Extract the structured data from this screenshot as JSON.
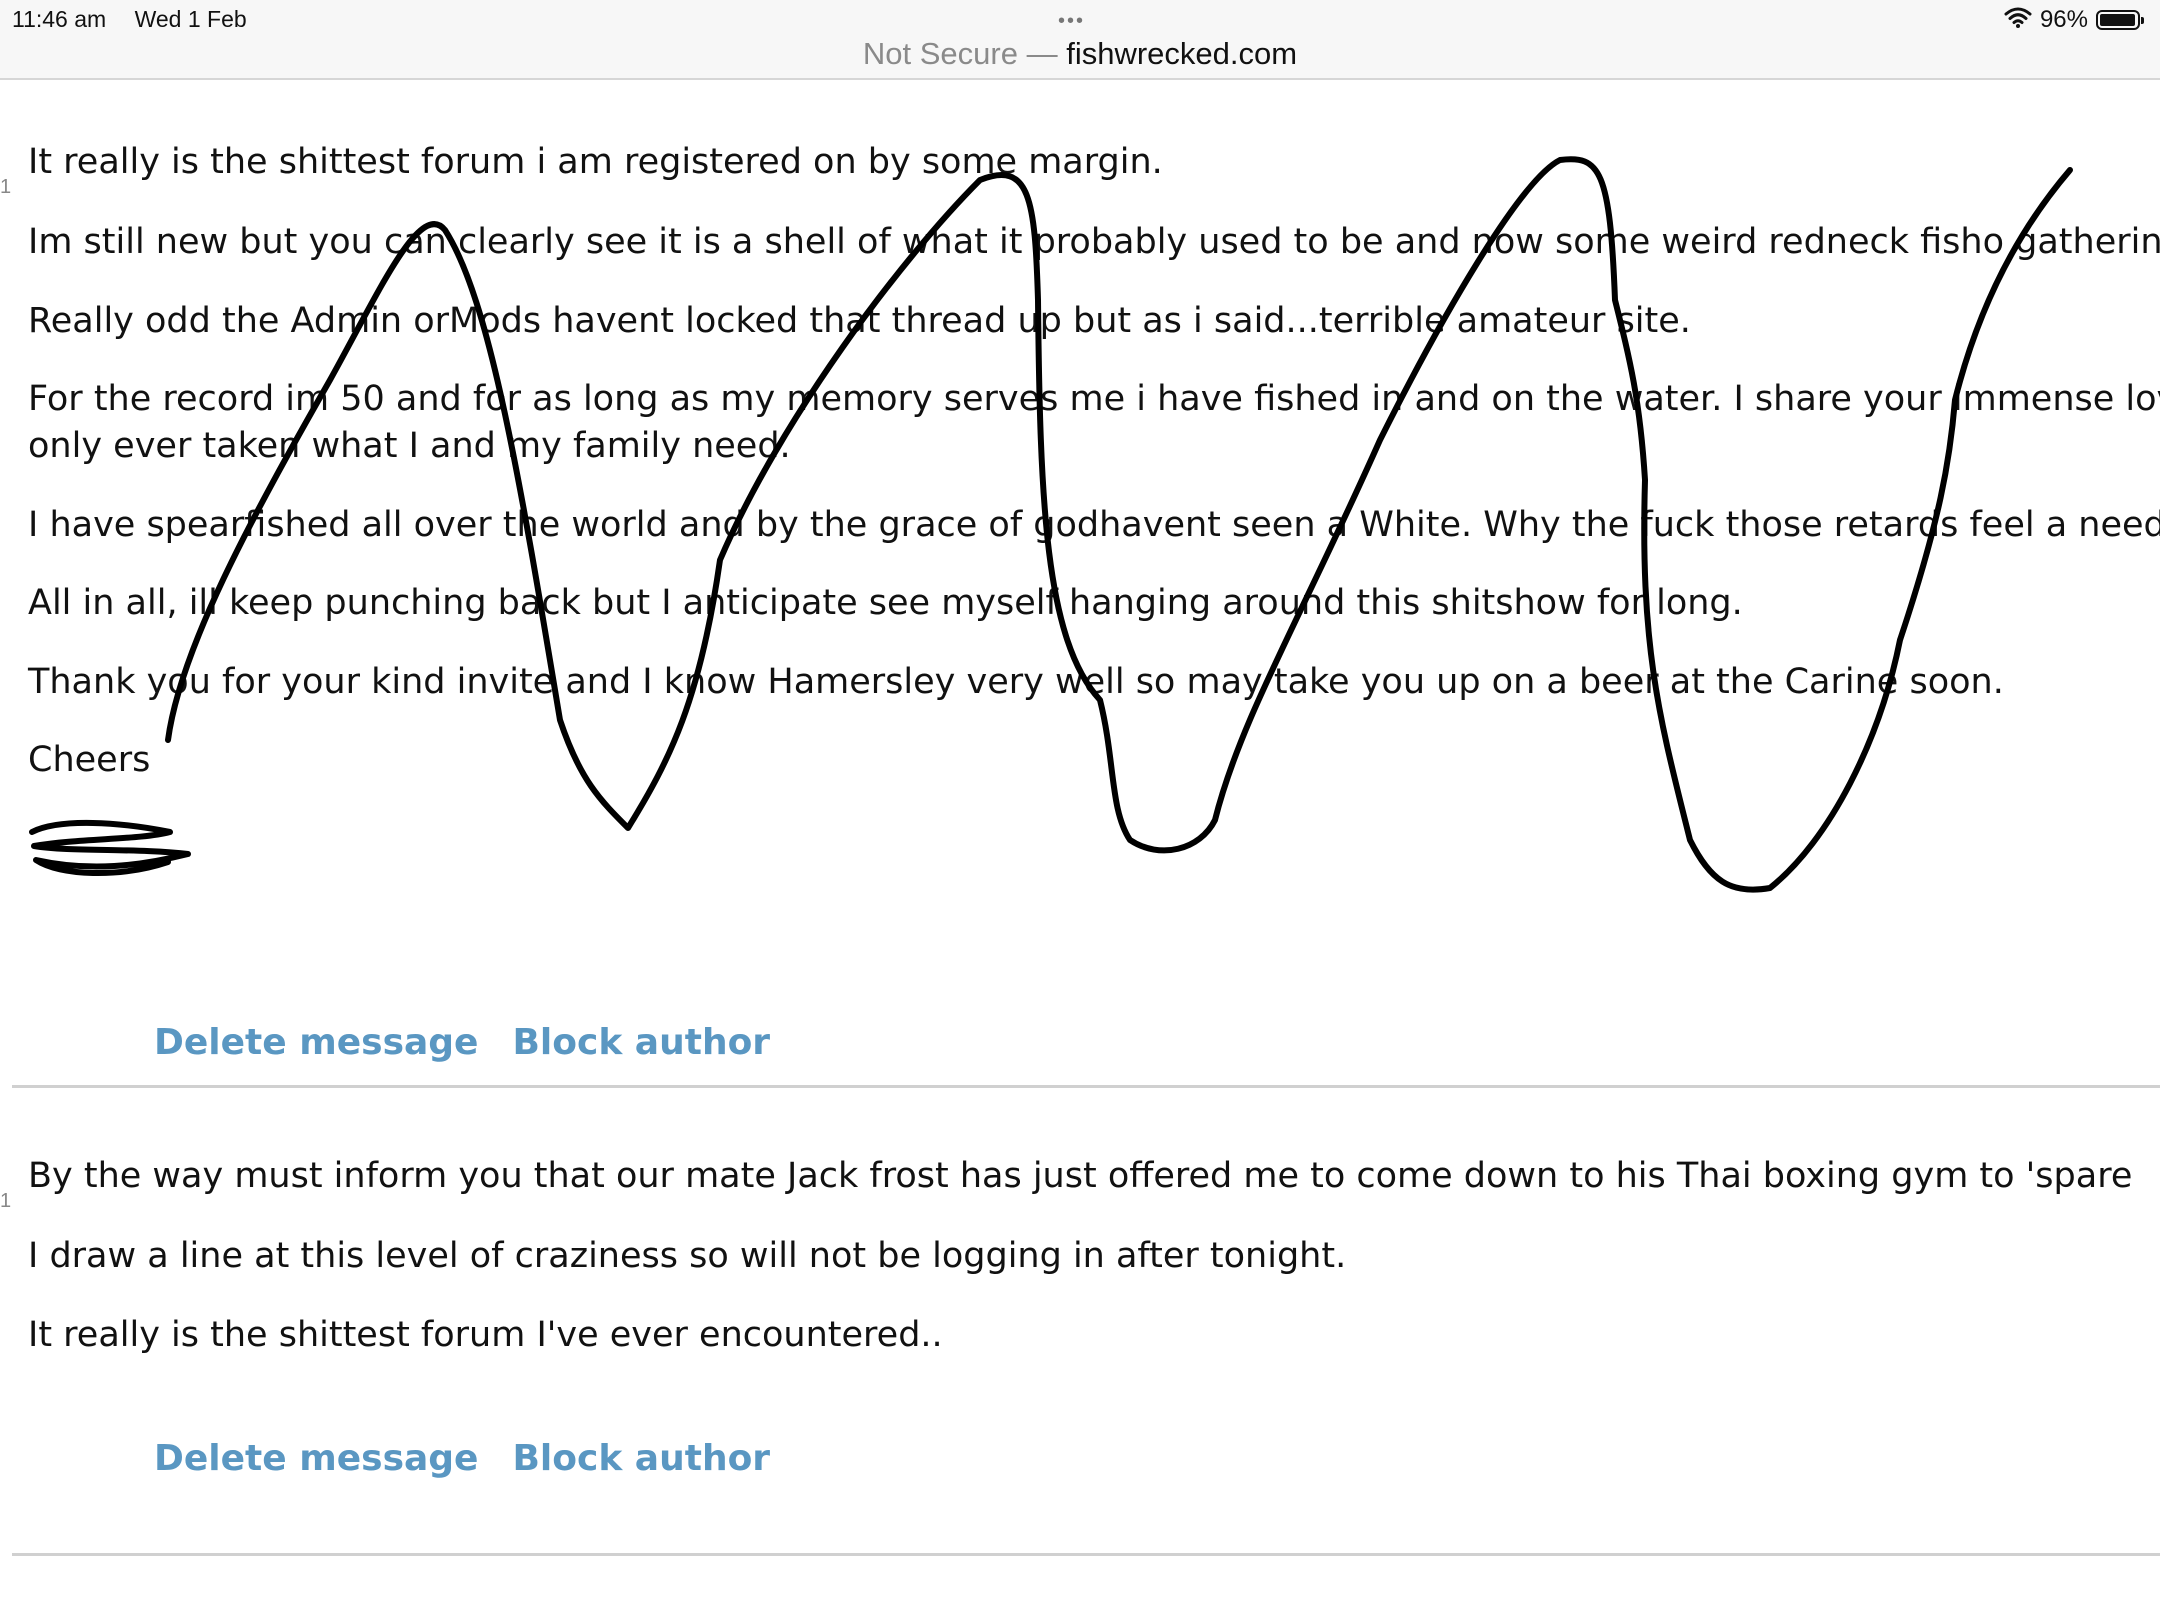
{
  "status_bar": {
    "time": "11:46 am",
    "date": "Wed 1 Feb",
    "battery": "96%",
    "battery_level": 0.96,
    "icons": [
      "wifi-icon",
      "battery-icon"
    ]
  },
  "browser": {
    "security_label": "Not Secure —",
    "domain": "fishwrecked.com"
  },
  "messages": [
    {
      "gutter": "1",
      "lines": [
        " It really is the shittest forum i am registered on by some margin.",
        "Im still new but you can clearly see it is a shell of what it probably used to be and now some weird redneck fisho gathering",
        "Really odd the Admin orMods havent locked that thread up but as i said...terrible amateur site.",
        "For the record im 50 and for as long as my memory serves me i have fished in and on the water. I share your immense lov",
        "only ever taken what I and my family need.",
        "I have spearfished all over the world and by the grace of godhavent seen a White. Why the fuck those retards feel a need",
        "All in all, ill keep punching back but I anticipate see myself hanging around this shitshow for long.",
        "Thank you for your kind invite and I know Hamersley very well so may take you up on a beer at the Carine soon.",
        "Cheers"
      ],
      "delete_label": "Delete message",
      "block_label": "Block author"
    },
    {
      "gutter": "1",
      "lines": [
        " By the way must inform you that our mate Jack frost has just offered me to come down to his Thai boxing gym to 'spare",
        "I draw a line at this level of craziness so will not be logging in after tonight.",
        "It really is the shittest forum I've ever encountered.."
      ],
      "delete_label": "Delete message",
      "block_label": "Block author"
    }
  ],
  "colors": {
    "link": "#5a97c2",
    "text": "#111111",
    "divider": "#d0d0d0",
    "topbar": "#f7f7f7"
  }
}
